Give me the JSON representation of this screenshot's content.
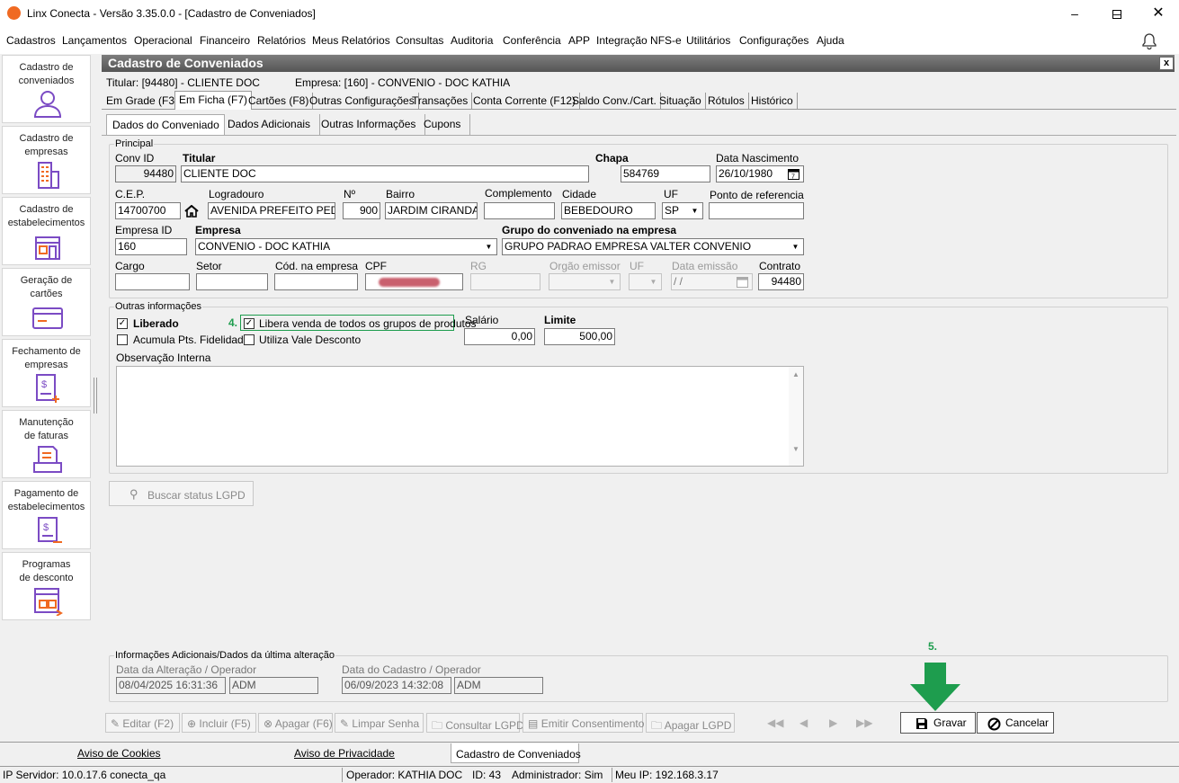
{
  "window": {
    "title": "Linx Conecta - Versão 3.35.0.0 - [Cadastro de Conveniados]"
  },
  "menu": [
    "Cadastros",
    "Lançamentos",
    "Operacional",
    "Financeiro",
    "Relatórios",
    "Meus Relatórios",
    "Consultas",
    "Auditoria",
    "Conferência",
    "APP",
    "Integração NFS-e",
    "Utilitários",
    "Configurações",
    "Ajuda"
  ],
  "sidebar": {
    "items": [
      {
        "line1": "Cadastro de",
        "line2": "conveniados",
        "icon": "user-icon"
      },
      {
        "line1": "Cadastro de",
        "line2": "empresas",
        "icon": "building-icon"
      },
      {
        "line1": "Cadastro de",
        "line2": "estabelecimentos",
        "icon": "store-icon"
      },
      {
        "line1": "Geração de",
        "line2": "cartões",
        "icon": "card-icon"
      },
      {
        "line1": "Fechamento de",
        "line2": "empresas",
        "icon": "invoice-icon"
      },
      {
        "line1": "Manutenção",
        "line2": "de faturas",
        "icon": "tray-icon"
      },
      {
        "line1": "Pagamento de",
        "line2": "estabelecimentos",
        "icon": "payment-icon"
      },
      {
        "line1": "Programas",
        "line2": "de desconto",
        "icon": "discount-icon"
      }
    ]
  },
  "form": {
    "title": "Cadastro de Conveniados",
    "close": "x",
    "titular_info": "Titular: [94480] - CLIENTE DOC",
    "empresa_info": "Empresa: [160] - CONVENIO -  DOC KATHIA"
  },
  "tabs": [
    "Em Grade (F3)",
    "Em Ficha (F7)",
    "Cartões (F8)",
    "Outras Configurações",
    "Transações",
    "Conta Corrente (F12)",
    "Saldo Conv./Cart.",
    "Situação",
    "Rótulos",
    "Histórico"
  ],
  "subtabs": [
    "Dados do Conveniado",
    "Dados Adicionais",
    "Outras Informações",
    "Cupons"
  ],
  "principal": {
    "group": "Principal",
    "conv_id_label": "Conv ID",
    "conv_id": "94480",
    "titular_label": "Titular",
    "titular": "CLIENTE DOC",
    "chapa_label": "Chapa",
    "chapa": "584769",
    "nasc_label": "Data Nascimento",
    "nasc": "26/10/1980",
    "cep_label": "C.E.P.",
    "cep": "14700700",
    "logradouro_label": "Logradouro",
    "logradouro": "AVENIDA PREFEITO PEDR",
    "numero_label": "Nº",
    "numero": "900",
    "bairro_label": "Bairro",
    "bairro": "JARDIM CIRANDA",
    "complemento_label": "Complemento",
    "complemento": "",
    "cidade_label": "Cidade",
    "cidade": "BEBEDOURO",
    "uf_label": "UF",
    "uf": "SP",
    "ponto_label": "Ponto de referencia",
    "ponto": "",
    "empresa_id_label": "Empresa ID",
    "empresa_id": "160",
    "empresa_label": "Empresa",
    "empresa": "CONVENIO -  DOC KATHIA",
    "grupo_label": "Grupo do conveniado na empresa",
    "grupo": "GRUPO PADRAO EMPRESA VALTER CONVENIO",
    "cargo_label": "Cargo",
    "setor_label": "Setor",
    "cod_label": "Cód. na empresa",
    "cpf_label": "CPF",
    "rg_label": "RG",
    "orgao_label": "Orgão emissor",
    "uf2_label": "UF",
    "emissao_label": "Data emissão",
    "emissao": " / /",
    "contrato_label": "Contrato",
    "contrato": "94480"
  },
  "outras": {
    "group": "Outras informações",
    "liberado": "Liberado",
    "libera_venda": "Libera venda de todos os grupos de produtos",
    "acumula": "Acumula Pts. Fidelidade",
    "vale": "Utiliza Vale Desconto",
    "salario_label": "Salário",
    "salario": "0,00",
    "limite_label": "Limite",
    "limite": "500,00",
    "obs_label": "Observação Interna",
    "step4": "4."
  },
  "lgpd_button": "Buscar status LGPD",
  "info_adicionais": {
    "group": "Informações Adicionais/Dados da última alteração",
    "alt_label": "Data da Alteração / Operador",
    "alt_date": "08/04/2025 16:31:36",
    "alt_op": "ADM",
    "cad_label": "Data do Cadastro / Operador",
    "cad_date": "06/09/2023 14:32:08",
    "cad_op": "ADM"
  },
  "step5": "5.",
  "toolbar": {
    "editar": "Editar (F2)",
    "incluir": "Incluir (F5)",
    "apagar": "Apagar (F6)",
    "limpar": "Limpar Senha",
    "consultar": "Consultar LGPD",
    "emitir": "Emitir Consentimento",
    "apagar_lgpd": "Apagar LGPD",
    "gravar": "Gravar",
    "cancelar": "Cancelar"
  },
  "status1": {
    "cookies": "Aviso de Cookies",
    "privacidade": "Aviso de Privacidade",
    "current": "Cadastro de Conveniados"
  },
  "status2": {
    "servidor": "IP Servidor: 10.0.17.6 conecta_qa",
    "operador": "Operador: KATHIA DOC",
    "id": "ID: 43",
    "admin": "Administrador: Sim",
    "ip": "Meu IP: 192.168.3.17"
  },
  "colors": {
    "accent_green": "#1e9d4e",
    "logo_orange": "#f06a22",
    "icon_purple": "#7b4bc4"
  }
}
